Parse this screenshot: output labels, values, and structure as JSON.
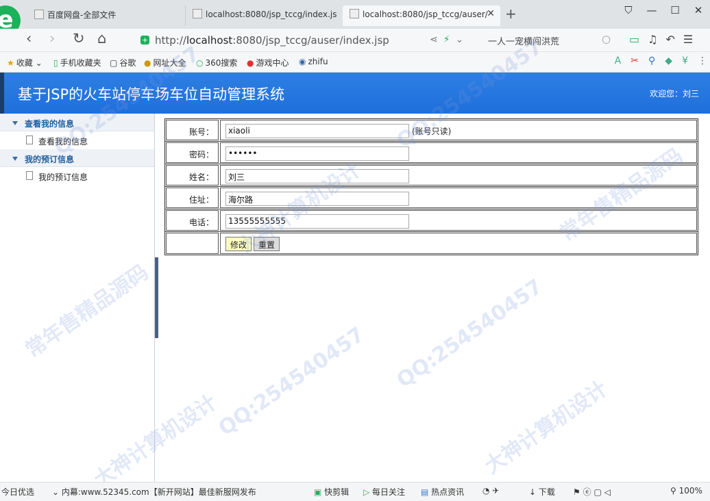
{
  "browser": {
    "tabs": [
      {
        "label": "百度网盘-全部文件"
      },
      {
        "label": "localhost:8080/jsp_tccg/index.js"
      },
      {
        "label": "localhost:8080/jsp_tccg/auser/"
      }
    ],
    "url_scheme": "http://",
    "url_host": "localhost",
    "url_rest": ":8080/jsp_tccg/auser/index.jsp",
    "search_text": "一人一宠横闯洪荒",
    "favorites": [
      "收藏",
      "手机收藏夹",
      "谷歌",
      "网址大全",
      "360搜索",
      "游戏中心",
      "zhifu"
    ]
  },
  "app": {
    "title": "基于JSP的火车站停车场车位自动管理系统",
    "welcome": "欢迎您：刘三"
  },
  "sidebar": {
    "sections": [
      {
        "label": "查看我的信息",
        "items": [
          {
            "label": "查看我的信息"
          }
        ]
      },
      {
        "label": "我的预订信息",
        "items": [
          {
            "label": "我的预订信息"
          }
        ]
      }
    ]
  },
  "form": {
    "account_label": "账号：",
    "account_value": "xiaoli",
    "account_note": "(账号只读)",
    "password_label": "密码：",
    "password_value": "••••••",
    "name_label": "姓名：",
    "name_value": "刘三",
    "address_label": "住址：",
    "address_value": "海尔路",
    "phone_label": "电话：",
    "phone_value": "13555555555",
    "submit_label": "修改",
    "reset_label": "重置"
  },
  "statusbar": {
    "left": "今日优选",
    "news": "内幕:www.52345.com【新开网站】最佳新服网发布",
    "items": [
      "快剪辑",
      "每日关注",
      "热点资讯",
      "下载"
    ],
    "zoom": "100%"
  },
  "watermark": {
    "texts": [
      "QQ:254540457",
      "大神计算机设计",
      "常年售精品源码"
    ]
  }
}
